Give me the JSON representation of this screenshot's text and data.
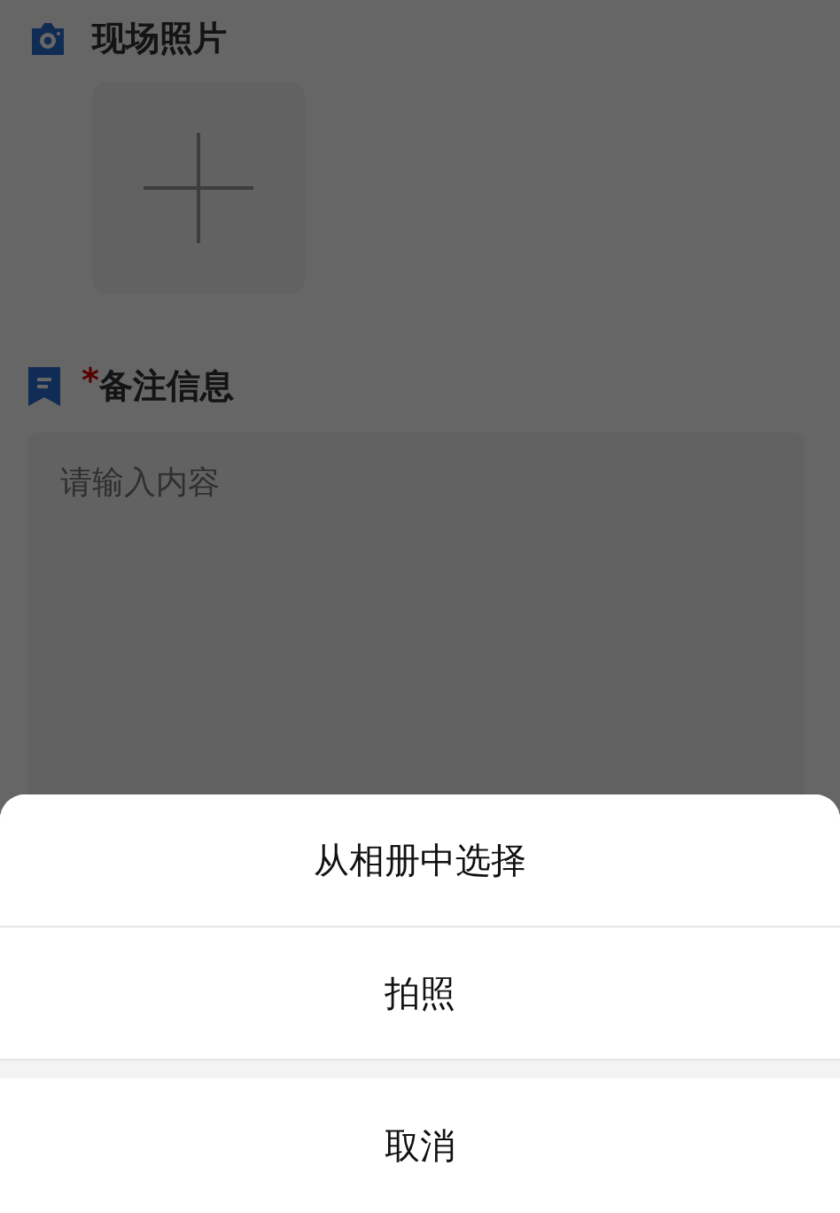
{
  "sections": [
    {
      "kind": "photos",
      "title": "现场照片"
    },
    {
      "kind": "note",
      "title": "备注信息",
      "required_mark": "*",
      "placeholder": "请输入内容"
    }
  ],
  "action_sheet": {
    "options": [
      "从相册中选择",
      "拍照"
    ],
    "cancel": "取消"
  }
}
